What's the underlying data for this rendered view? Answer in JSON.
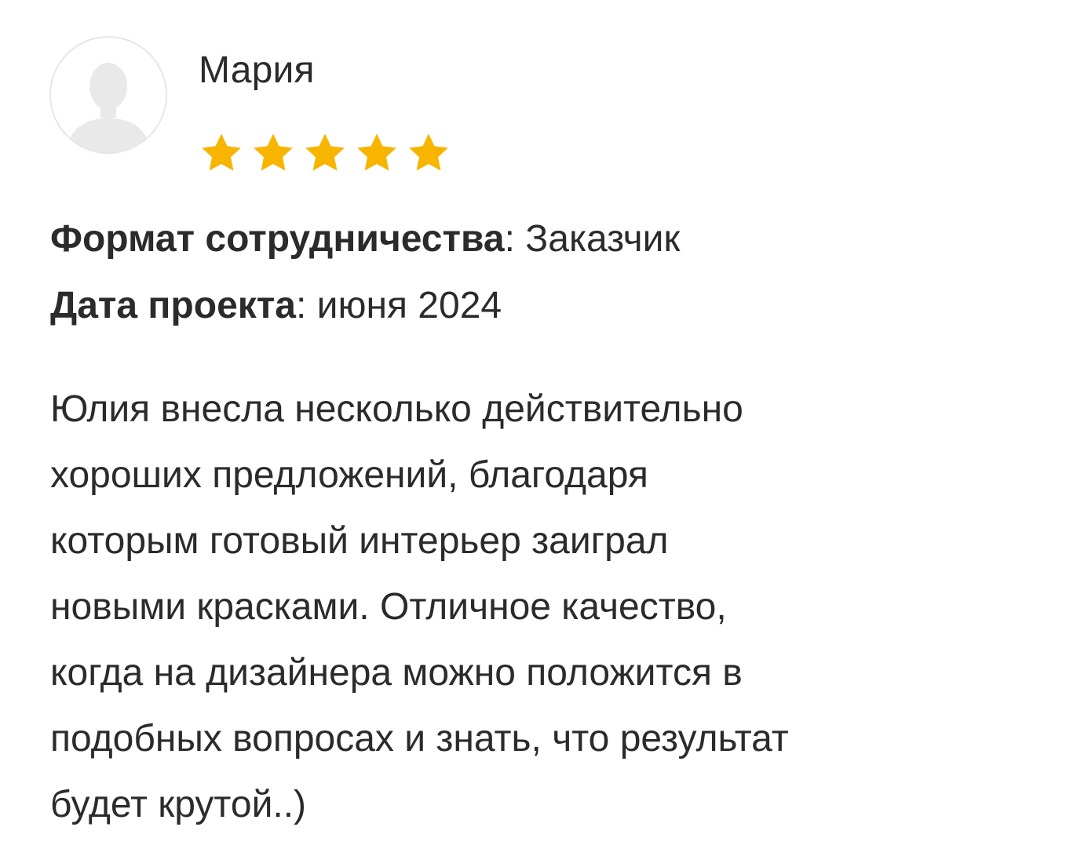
{
  "review": {
    "author": {
      "name": "Мария",
      "avatar_icon": "user-silhouette-icon"
    },
    "rating": {
      "value": 5,
      "max": 5,
      "star_icon": "star-icon",
      "star_color": "#F7B500"
    },
    "meta": {
      "format_label": "Формат сотрудничества",
      "format_value": "Заказчик",
      "date_label": "Дата проекта",
      "date_value": "июня 2024",
      "separator": ": "
    },
    "text_lines": [
      "Юлия внесла несколько действительно",
      "хороших предложений, благодаря",
      "которым готовый интерьер заиграл",
      "новыми красками. Отличное качество,",
      "когда на дизайнера можно положится в",
      "подобных вопросах и знать, что результат",
      "будет крутой..)"
    ]
  }
}
